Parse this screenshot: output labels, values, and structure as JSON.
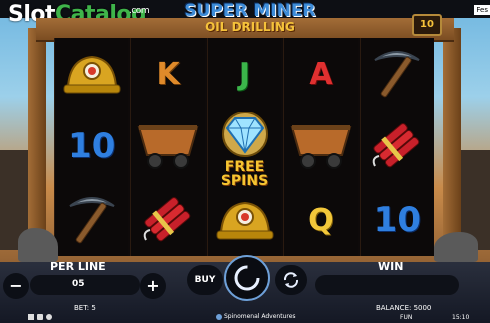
{
  "watermark": {
    "part1": "Slot",
    "part2": "Catalog",
    "suffix": ".com"
  },
  "corner_text": "Fes",
  "game_title": {
    "line1": "SUPER MINER",
    "line2": "OIL DRILLING"
  },
  "bet_badge": "10",
  "reels": [
    [
      {
        "symbol": "miner-helmet",
        "label": ""
      },
      {
        "symbol": "ten",
        "label": "10"
      },
      {
        "symbol": "pickaxe",
        "label": ""
      }
    ],
    [
      {
        "symbol": "k",
        "label": "K"
      },
      {
        "symbol": "mine-cart",
        "label": ""
      },
      {
        "symbol": "dynamite",
        "label": ""
      }
    ],
    [
      {
        "symbol": "j",
        "label": "J"
      },
      {
        "symbol": "diamond-free-spins",
        "label": "FREE SPINS"
      },
      {
        "symbol": "miner-helmet",
        "label": ""
      }
    ],
    [
      {
        "symbol": "a",
        "label": "A"
      },
      {
        "symbol": "mine-cart",
        "label": ""
      },
      {
        "symbol": "q",
        "label": "Q"
      }
    ],
    [
      {
        "symbol": "pickaxe",
        "label": ""
      },
      {
        "symbol": "dynamite",
        "label": ""
      },
      {
        "symbol": "ten",
        "label": "10"
      }
    ]
  ],
  "controls": {
    "per_line_label": "PER LINE",
    "per_line_value": "05",
    "minus": "−",
    "plus": "+",
    "buy_label": "BUY",
    "win_label": "WIN"
  },
  "status": {
    "bet": "BET: 5",
    "balance": "BALANCE: 5000",
    "mode": "FUN",
    "time": "15:10",
    "provider": "Spinomenal Adventures"
  }
}
